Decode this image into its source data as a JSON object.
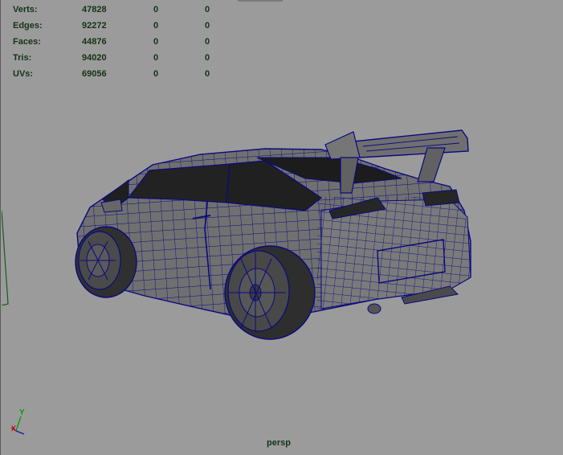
{
  "hud": {
    "rows": [
      {
        "label": "Verts:",
        "total": "47828",
        "selected": "0",
        "components": "0"
      },
      {
        "label": "Edges:",
        "total": "92272",
        "selected": "0",
        "components": "0"
      },
      {
        "label": "Faces:",
        "total": "44876",
        "selected": "0",
        "components": "0"
      },
      {
        "label": "Tris:",
        "total": "94020",
        "selected": "0",
        "components": "0"
      },
      {
        "label": "UVs:",
        "total": "69056",
        "selected": "0",
        "components": "0"
      }
    ]
  },
  "viewport": {
    "camera_label": "persp",
    "background_color": "#9b9b9b",
    "wireframe_color": "#0a0a80",
    "model_color": "#6e6e6e"
  },
  "axis_gizmo": {
    "y_label": "Y",
    "x_label": "X",
    "y_color": "#0c9a0c",
    "x_color": "#b31414",
    "z_color": "#1414b3"
  },
  "icons": {
    "axis": "axis-gizmo-icon"
  }
}
